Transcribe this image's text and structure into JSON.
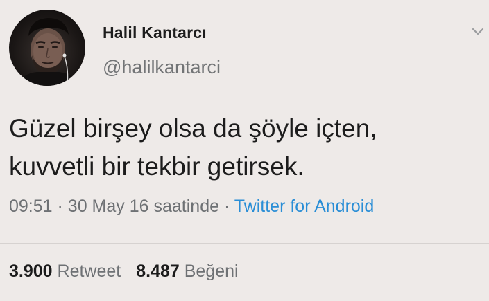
{
  "user": {
    "display_name": "Halil Kantarcı",
    "handle": "@halilkantarci"
  },
  "tweet": {
    "lines": [
      "Güzel birşey olsa da şöyle içten,",
      "kuvvetli bir tekbir getirsek."
    ],
    "time": "09:51",
    "separator": "·",
    "date_text": "30 May 16 saatinde",
    "source": "Twitter for Android"
  },
  "stats": {
    "retweets_count": "3.900",
    "retweets_label": "Retweet",
    "likes_count": "8.487",
    "likes_label": "Beğeni"
  },
  "icons": {
    "caret": "chevron-down-icon",
    "avatar": "profile-photo"
  },
  "colors": {
    "background": "#eeeae8",
    "link": "#2a8ed6",
    "muted": "#6e7174"
  }
}
